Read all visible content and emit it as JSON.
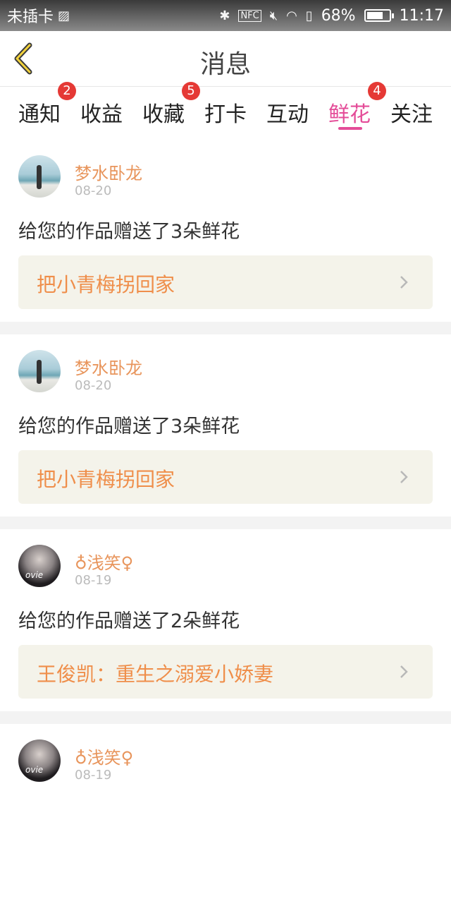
{
  "status_bar": {
    "carrier": "未插卡",
    "nfc": "NFC",
    "battery": "68%",
    "time": "11:17"
  },
  "header": {
    "title": "消息"
  },
  "tabs": [
    {
      "label": "通知",
      "badge": "2"
    },
    {
      "label": "收益"
    },
    {
      "label": "收藏",
      "badge": "5"
    },
    {
      "label": "打卡"
    },
    {
      "label": "互动"
    },
    {
      "label": "鲜花",
      "badge": "4",
      "active": true
    },
    {
      "label": "关注"
    }
  ],
  "messages": [
    {
      "user": "梦水卧龙",
      "date": "08-20",
      "text": "给您的作品赠送了3朵鲜花",
      "work": "把小青梅拐回家"
    },
    {
      "user": "梦水卧龙",
      "date": "08-20",
      "text": "给您的作品赠送了3朵鲜花",
      "work": "把小青梅拐回家"
    },
    {
      "user": "♁浅笑♀",
      "date": "08-19",
      "text": "给您的作品赠送了2朵鲜花",
      "work": "王俊凯：重生之溺爱小娇妻"
    },
    {
      "user": "♁浅笑♀",
      "date": "08-19"
    }
  ],
  "colors": {
    "accent_pink": "#e44c98",
    "badge_red": "#e53935",
    "name_orange": "#e8955c",
    "work_orange": "#ef8e4a",
    "work_bg": "#f4f3ea"
  }
}
